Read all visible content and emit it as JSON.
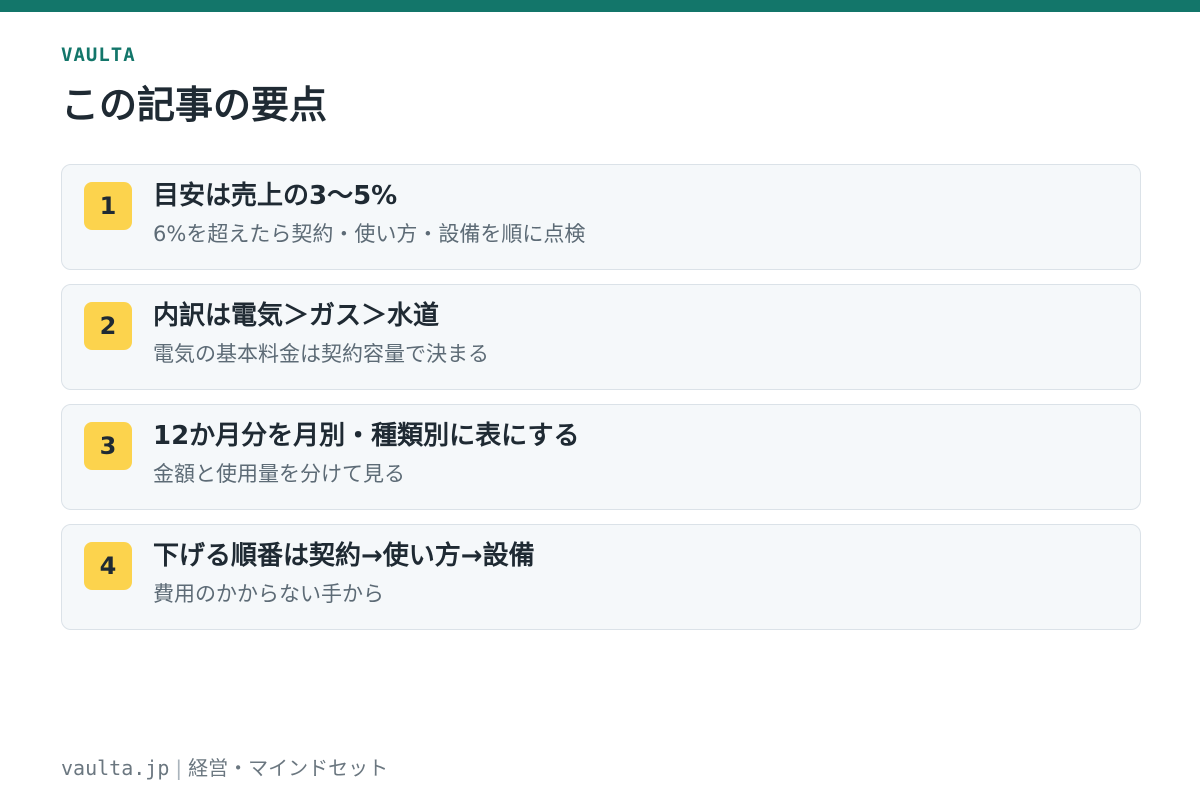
{
  "brand": "VAULTA",
  "title": "この記事の要点",
  "points": [
    {
      "number": "1",
      "title": "目安は売上の3〜5%",
      "subtitle": "6%を超えたら契約・使い方・設備を順に点検"
    },
    {
      "number": "2",
      "title": "内訳は電気＞ガス＞水道",
      "subtitle": "電気の基本料金は契約容量で決まる"
    },
    {
      "number": "3",
      "title": "12か月分を月別・種類別に表にする",
      "subtitle": "金額と使用量を分けて見る"
    },
    {
      "number": "4",
      "title": "下げる順番は契約→使い方→設備",
      "subtitle": "費用のかからない手から"
    }
  ],
  "footer": {
    "domain": "vaulta.jp",
    "separator": "|",
    "category": "経営・マインドセット"
  },
  "colors": {
    "accent": "#13766a",
    "badge": "#fcd34d",
    "card_bg": "#f5f8fa",
    "card_border": "#dbe2e8"
  }
}
